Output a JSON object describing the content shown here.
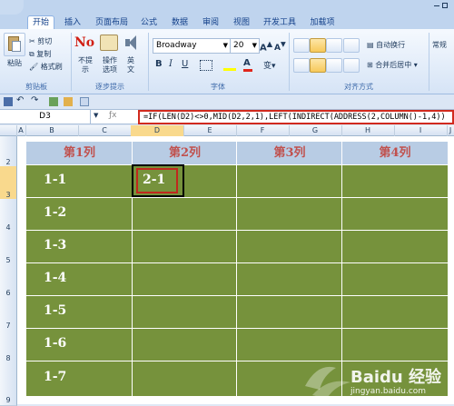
{
  "ribbon_tabs": [
    "开始",
    "插入",
    "页面布局",
    "公式",
    "数据",
    "审阅",
    "视图",
    "开发工具",
    "加载项"
  ],
  "clipboard": {
    "paste": "粘贴",
    "cut": "剪切",
    "copy": "复制",
    "format_painter": "格式刷",
    "group": "剪贴板"
  },
  "prompt": {
    "no_prompt": "不提示",
    "options": "操作选项",
    "english": "英文",
    "group": "逐步提示"
  },
  "font": {
    "name": "Broadway",
    "size": "20",
    "group": "字体"
  },
  "alignment": {
    "wrap": "自动换行",
    "merge": "合并后居中",
    "group": "对齐方式"
  },
  "number": {
    "format": "常规"
  },
  "name_box": "D3",
  "formula": "=IF(LEN(D2)<>0,MID(D2,2,1),LEFT(INDIRECT(ADDRESS(2,COLUMN()-1,4))",
  "columns": [
    "A",
    "B",
    "C",
    "D",
    "E",
    "F",
    "G",
    "H",
    "I",
    "J"
  ],
  "rows": [
    "2",
    "3",
    "4",
    "5",
    "6",
    "7",
    "8",
    "9"
  ],
  "headers": [
    "第1列",
    "第2列",
    "第3列",
    "第4列"
  ],
  "row_labels": [
    "1-1",
    "1-2",
    "1-3",
    "1-4",
    "1-5",
    "1-6",
    "1-7"
  ],
  "d3_value": "2-1",
  "watermark": {
    "brand": "Baidu 经验",
    "url": "jingyan.baidu.com"
  },
  "colors": {
    "green": "#76923c",
    "header_blue": "#b8cce4",
    "header_text": "#c0504d",
    "highlight_red": "#c0281d"
  }
}
